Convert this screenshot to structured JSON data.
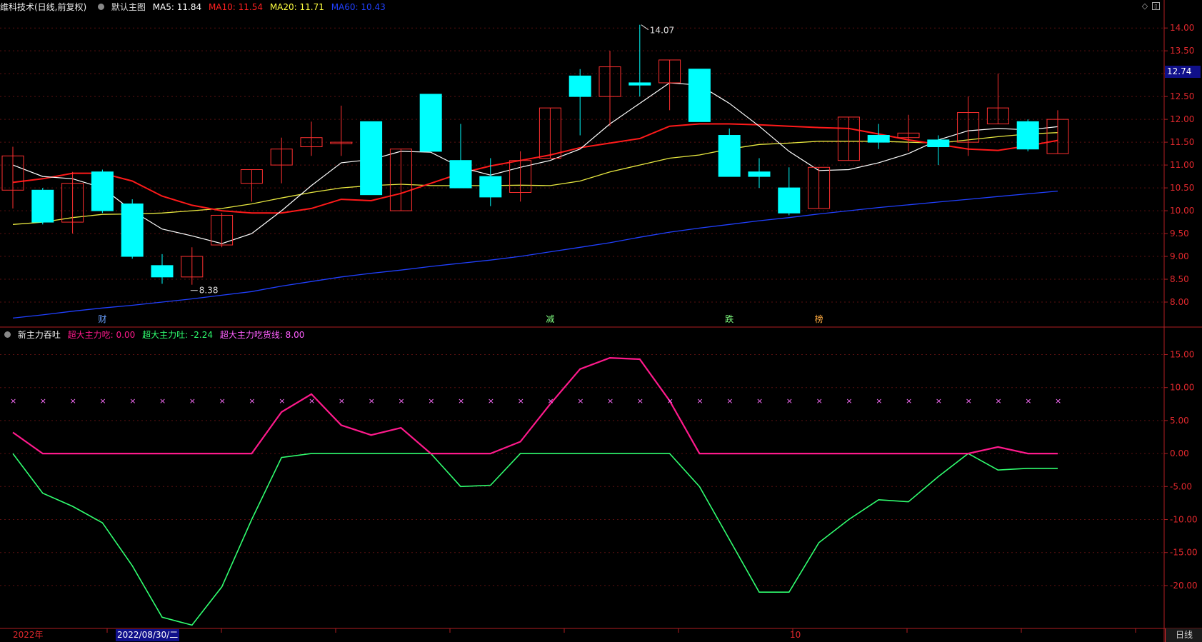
{
  "header": {
    "stock_title": "维科技术(日线,前复权)",
    "chart_mode": "默认主图",
    "ma5": {
      "label": "MA5: 11.84",
      "color": "#ffffff"
    },
    "ma10": {
      "label": "MA10: 11.54",
      "color": "#ff2020"
    },
    "ma20": {
      "label": "MA20: 11.71",
      "color": "#ffff40"
    },
    "ma60": {
      "label": "MA60: 10.43",
      "color": "#2040ff"
    }
  },
  "indicator": {
    "name": "新主力吞吐",
    "buy_label": "超大主力吃: 0.00",
    "sell_label": "超大主力吐: -2.24",
    "line_label": "超大主力吃货线: 8.00",
    "buy_color": "#ff1a8c",
    "sell_color": "#30ff70",
    "line_color": "#ff60ff"
  },
  "price_axis": [
    "14.00",
    "13.50",
    "13.00",
    "12.50",
    "12.00",
    "11.50",
    "11.00",
    "10.50",
    "10.00",
    "9.50",
    "9.00",
    "8.50",
    "8.00"
  ],
  "indicator_axis": [
    "15.00",
    "10.00",
    "5.00",
    "0.00",
    "-5.00",
    "-10.00",
    "-15.00",
    "-20.00"
  ],
  "current_price": "12.74",
  "high_annotation": "14.07",
  "low_annotation": "8.38",
  "event_markers": [
    {
      "text": "财",
      "index": 3,
      "color": "#6aa0ff"
    },
    {
      "text": "减",
      "index": 18,
      "color": "#80ff80"
    },
    {
      "text": "跌",
      "index": 24,
      "color": "#80ff80"
    },
    {
      "text": "榜",
      "index": 27,
      "color": "#ffaa40"
    }
  ],
  "time_axis": {
    "year_label": "2022年",
    "selected_date": "2022/08/30/二",
    "month_label": "10"
  },
  "period_button": "日线",
  "chart_data": {
    "type": "candlestick",
    "candles": [
      {
        "o": 10.45,
        "c": 11.2,
        "h": 11.4,
        "l": 10.05
      },
      {
        "o": 10.45,
        "c": 9.75,
        "h": 10.5,
        "l": 9.7
      },
      {
        "o": 9.75,
        "c": 10.6,
        "h": 10.85,
        "l": 9.5
      },
      {
        "o": 10.85,
        "c": 10.0,
        "h": 10.9,
        "l": 9.95
      },
      {
        "o": 10.15,
        "c": 9.0,
        "h": 10.25,
        "l": 8.95
      },
      {
        "o": 8.8,
        "c": 8.55,
        "h": 9.05,
        "l": 8.4
      },
      {
        "o": 8.55,
        "c": 9.0,
        "h": 9.2,
        "l": 8.38
      },
      {
        "o": 9.25,
        "c": 9.9,
        "h": 9.95,
        "l": 9.2
      },
      {
        "o": 10.6,
        "c": 10.9,
        "h": 10.9,
        "l": 10.2
      },
      {
        "o": 11.0,
        "c": 11.35,
        "h": 11.6,
        "l": 10.6
      },
      {
        "o": 11.4,
        "c": 11.6,
        "h": 11.95,
        "l": 11.2
      },
      {
        "o": 11.5,
        "c": 11.5,
        "h": 12.3,
        "l": 11.2
      },
      {
        "o": 11.95,
        "c": 10.35,
        "h": 11.95,
        "l": 10.35
      },
      {
        "o": 10.0,
        "c": 11.35,
        "h": 11.35,
        "l": 10.0
      },
      {
        "o": 12.55,
        "c": 11.3,
        "h": 12.55,
        "l": 11.3
      },
      {
        "o": 11.1,
        "c": 10.5,
        "h": 11.9,
        "l": 10.5
      },
      {
        "o": 10.75,
        "c": 10.3,
        "h": 11.15,
        "l": 10.1
      },
      {
        "o": 10.4,
        "c": 11.1,
        "h": 11.3,
        "l": 10.2
      },
      {
        "o": 11.15,
        "c": 12.25,
        "h": 12.25,
        "l": 11.15
      },
      {
        "o": 12.95,
        "c": 12.5,
        "h": 13.1,
        "l": 11.65
      },
      {
        "o": 12.5,
        "c": 13.15,
        "h": 13.5,
        "l": 11.85
      },
      {
        "o": 12.8,
        "c": 12.75,
        "h": 14.07,
        "l": 12.5
      },
      {
        "o": 12.8,
        "c": 13.3,
        "h": 13.3,
        "l": 12.2
      },
      {
        "o": 13.1,
        "c": 11.95,
        "h": 13.1,
        "l": 11.95
      },
      {
        "o": 11.65,
        "c": 10.75,
        "h": 11.8,
        "l": 10.75
      },
      {
        "o": 10.85,
        "c": 10.75,
        "h": 11.15,
        "l": 10.5
      },
      {
        "o": 10.5,
        "c": 9.95,
        "h": 10.95,
        "l": 9.9
      },
      {
        "o": 10.05,
        "c": 10.95,
        "h": 10.95,
        "l": 10.05
      },
      {
        "o": 11.1,
        "c": 12.05,
        "h": 12.05,
        "l": 11.1
      },
      {
        "o": 11.65,
        "c": 11.5,
        "h": 11.9,
        "l": 11.35
      },
      {
        "o": 11.6,
        "c": 11.7,
        "h": 12.1,
        "l": 11.3
      },
      {
        "o": 11.55,
        "c": 11.4,
        "h": 11.65,
        "l": 11.0
      },
      {
        "o": 11.5,
        "c": 12.15,
        "h": 12.5,
        "l": 11.2
      },
      {
        "o": 11.9,
        "c": 12.25,
        "h": 13.0,
        "l": 11.9
      },
      {
        "o": 11.95,
        "c": 11.35,
        "h": 12.0,
        "l": 11.3
      },
      {
        "o": 11.25,
        "c": 12.0,
        "h": 12.2,
        "l": 11.25
      }
    ],
    "ma5": [
      11.0,
      10.75,
      10.7,
      10.5,
      10.0,
      9.6,
      9.45,
      9.28,
      9.5,
      10.0,
      10.55,
      11.05,
      11.12,
      11.3,
      11.28,
      10.95,
      10.78,
      10.95,
      11.1,
      11.35,
      11.9,
      12.35,
      12.8,
      12.75,
      12.35,
      11.85,
      11.3,
      10.88,
      10.9,
      11.05,
      11.25,
      11.55,
      11.75,
      11.8,
      11.77,
      11.84
    ],
    "ma10": [
      10.62,
      10.7,
      10.82,
      10.82,
      10.65,
      10.32,
      10.12,
      10.0,
      9.95,
      9.95,
      10.05,
      10.25,
      10.22,
      10.38,
      10.6,
      10.82,
      10.98,
      11.1,
      11.22,
      11.38,
      11.48,
      11.58,
      11.85,
      11.9,
      11.9,
      11.88,
      11.85,
      11.82,
      11.8,
      11.68,
      11.55,
      11.45,
      11.35,
      11.32,
      11.42,
      11.54
    ],
    "ma20": [
      9.7,
      9.75,
      9.85,
      9.92,
      9.93,
      9.95,
      10.0,
      10.05,
      10.15,
      10.28,
      10.4,
      10.5,
      10.55,
      10.58,
      10.55,
      10.55,
      10.55,
      10.56,
      10.55,
      10.65,
      10.85,
      11.0,
      11.15,
      11.22,
      11.35,
      11.45,
      11.48,
      11.52,
      11.52,
      11.52,
      11.5,
      11.48,
      11.55,
      11.62,
      11.68,
      11.71
    ],
    "ma60": [
      7.65,
      7.72,
      7.8,
      7.87,
      7.93,
      8.0,
      8.07,
      8.15,
      8.23,
      8.35,
      8.45,
      8.55,
      8.63,
      8.7,
      8.78,
      8.85,
      8.92,
      9.0,
      9.1,
      9.2,
      9.3,
      9.42,
      9.53,
      9.62,
      9.7,
      9.78,
      9.85,
      9.93,
      10.0,
      10.07,
      10.13,
      10.19,
      10.25,
      10.31,
      10.37,
      10.43
    ],
    "indicator_buy": [
      3.2,
      0,
      0,
      0,
      0,
      0,
      0,
      0,
      0,
      6.3,
      9.0,
      4.3,
      2.8,
      3.9,
      0,
      0,
      0,
      1.8,
      7.5,
      12.8,
      14.5,
      14.3,
      8.0,
      0,
      0,
      0,
      0,
      0,
      0,
      0,
      0,
      0,
      0,
      1.0,
      0,
      0
    ],
    "indicator_sell": [
      0,
      -6.0,
      -8.0,
      -10.5,
      -17.0,
      -24.8,
      -26.0,
      -20.2,
      -10.0,
      -0.6,
      0,
      0,
      0,
      0,
      0,
      -5.0,
      -4.8,
      0,
      0,
      0,
      0,
      0,
      0,
      -5.0,
      -13.0,
      -21.0,
      -21.0,
      -13.5,
      -10.0,
      -7.0,
      -7.3,
      -3.5,
      0,
      -2.5,
      -2.24,
      -2.24
    ],
    "indicator_line": 8.0,
    "price_range": [
      7.5,
      14.3
    ],
    "indicator_range": [
      -26.5,
      17.0
    ]
  }
}
